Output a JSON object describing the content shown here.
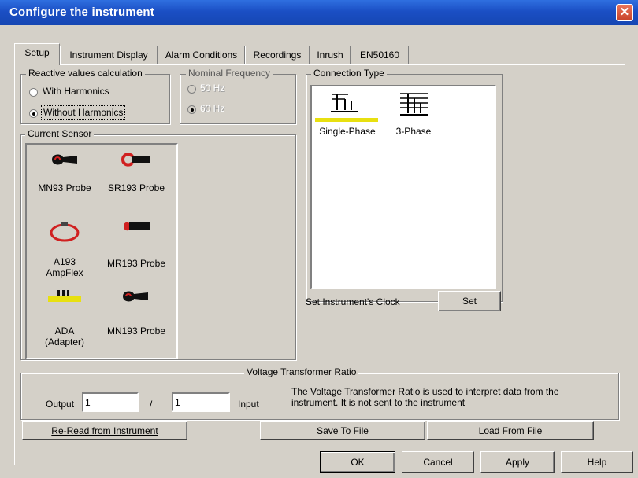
{
  "window": {
    "title": "Configure the instrument",
    "close_glyph": "✕"
  },
  "tabs": [
    "Setup",
    "Instrument Display",
    "Alarm Conditions",
    "Recordings",
    "Inrush",
    "EN50160"
  ],
  "reactive": {
    "label": "Reactive values calculation",
    "options": [
      {
        "label": "With Harmonics",
        "selected": false
      },
      {
        "label": "Without Harmonics",
        "selected": true
      }
    ]
  },
  "nominal_frequency": {
    "label": "Nominal Frequency",
    "options": [
      {
        "label": "50 Hz",
        "selected": false
      },
      {
        "label": "60 Hz",
        "selected": true
      }
    ]
  },
  "current_sensor": {
    "label": "Current Sensor",
    "items": [
      {
        "label": "MN93 Probe",
        "icon": "clamp-probe-icon"
      },
      {
        "label": "SR193 Probe",
        "icon": "sr-clamp-icon"
      },
      {
        "label": "A193\nAmpFlex",
        "icon": "ampflex-loop-icon"
      },
      {
        "label": "MR193 Probe",
        "icon": "mr-probe-icon"
      },
      {
        "label": "ADA\n(Adapter)",
        "icon": "adapter-icon"
      },
      {
        "label": "MN193 Probe",
        "icon": "clamp-probe-icon"
      }
    ]
  },
  "connection_type": {
    "label": "Connection Type",
    "items": [
      {
        "label": "Single-Phase",
        "icon": "single-phase-icon",
        "selected": true
      },
      {
        "label": "3-Phase",
        "icon": "three-phase-icon",
        "selected": false
      }
    ]
  },
  "clock": {
    "label": "Set Instrument's Clock",
    "button": "Set"
  },
  "vt_ratio": {
    "label": "Voltage Transformer Ratio",
    "output_label": "Output",
    "output_value": "1",
    "separator": "/",
    "input_value": "1",
    "input_label": "Input",
    "note": "The Voltage Transformer Ratio is used to interpret data from the instrument. It is not sent to the instrument"
  },
  "actions": {
    "reread": "Re-Read from Instrument",
    "save": "Save To File",
    "load": "Load From File"
  },
  "footer": {
    "ok": "OK",
    "cancel": "Cancel",
    "apply": "Apply",
    "help": "Help"
  },
  "colors": {
    "title_bar": "#1b4fc4",
    "face": "#d4d0c8",
    "adapter_yellow": "#e8e010",
    "clamp_red": "#d02020"
  }
}
